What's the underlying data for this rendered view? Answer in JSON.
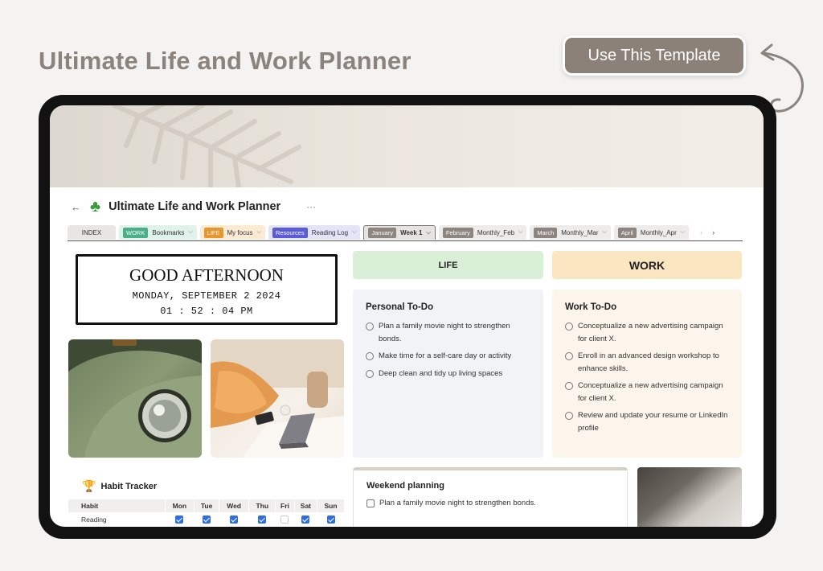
{
  "hero": {
    "title": "Ultimate Life and Work Planner",
    "cta_label": "Use This Template"
  },
  "page": {
    "icon": "four-leaf-clover-icon",
    "title": "Ultimate Life and Work Planner",
    "more": "···",
    "back": "←"
  },
  "tabs": [
    {
      "plain": "INDEX"
    },
    {
      "chip": "WORK",
      "chip_color": "#4caf8a",
      "label": "Bookmarks"
    },
    {
      "chip": "LIFE",
      "chip_color": "#e8962f",
      "label": "My focus"
    },
    {
      "chip": "Resources",
      "chip_color": "#5b5bd6",
      "label": "Reading Log"
    },
    {
      "chip": "January",
      "chip_color": "#8c8580",
      "label": "Week 1"
    },
    {
      "chip": "February",
      "chip_color": "#8c8580",
      "label": "Monthly_Feb"
    },
    {
      "chip": "March",
      "chip_color": "#8c8580",
      "label": "Monthly_Mar"
    },
    {
      "chip": "April",
      "chip_color": "#8c8580",
      "label": "Monthly_Apr"
    }
  ],
  "greeting": {
    "title": "GOOD AFTERNOON",
    "date": "MONDAY, SEPTEMBER 2 2024",
    "time": "01 : 52 : 04 PM"
  },
  "habit_tracker": {
    "icon": "trophy-icon",
    "title": "Habit Tracker",
    "columns": [
      "Habit",
      "Mon",
      "Tue",
      "Wed",
      "Thu",
      "Fri",
      "Sat",
      "Sun"
    ],
    "rows": [
      {
        "habit": "Reading",
        "checks": [
          true,
          true,
          true,
          true,
          false,
          true,
          true
        ]
      }
    ]
  },
  "life": {
    "header": "LIFE",
    "todo_title": "Personal To-Do",
    "items": [
      "Plan a family movie night to strengthen bonds.",
      "Make time for a self-care day or activity",
      "Deep clean and tidy up living spaces"
    ]
  },
  "work": {
    "header": "WORK",
    "todo_title": "Work To-Do",
    "items": [
      "Conceptualize a new advertising campaign for client X.",
      "Enroll in an advanced design workshop to enhance skills.",
      "Conceptualize a new advertising campaign for client X.",
      "Review and update your resume or LinkedIn profile"
    ]
  },
  "weekend": {
    "title": "Weekend planning",
    "items": [
      "Plan a family movie night to strengthen bonds."
    ]
  },
  "colors": {
    "accent_cta": "#8c8178",
    "life_header": "#d9f0d6",
    "work_header": "#fbe6c2",
    "check": "#2f6ee0"
  }
}
